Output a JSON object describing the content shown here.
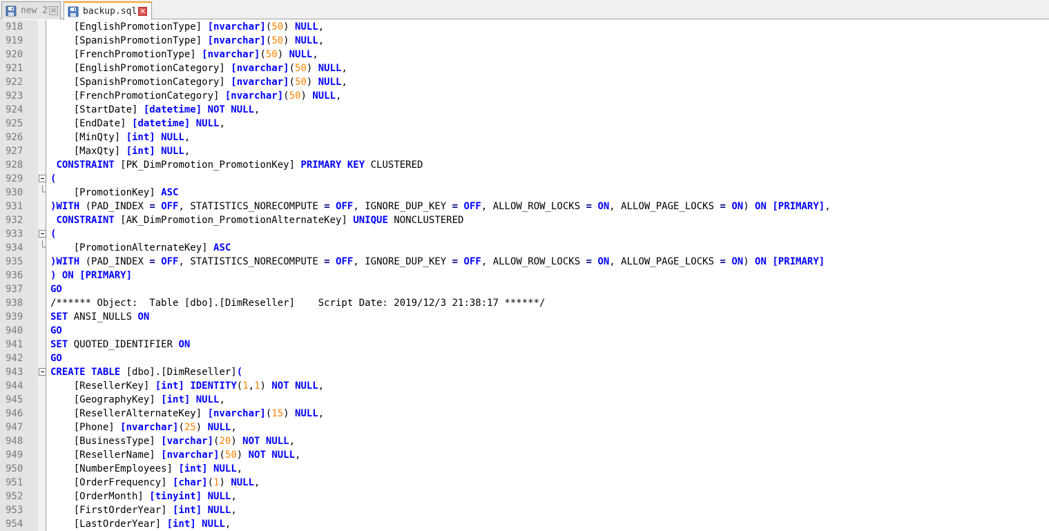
{
  "tabs": [
    {
      "label": "new 2",
      "active": false
    },
    {
      "label": "backup.sql",
      "active": true
    }
  ],
  "colors": {
    "keyword": "#0000ff",
    "number": "#ff8000",
    "operator": "#000080",
    "tab_accent": "#f6a623"
  },
  "icons": {
    "tab_icon": "save-disk-icon",
    "tab_close": "close-icon",
    "fold": "fold-minus-icon"
  },
  "editor": {
    "lines": [
      {
        "num": "918",
        "fold": "",
        "tokens": [
          [
            "t",
            "    [EnglishPromotionType] "
          ],
          [
            "k",
            "[nvarchar]"
          ],
          [
            "t",
            "("
          ],
          [
            "n",
            "50"
          ],
          [
            "t",
            ") "
          ],
          [
            "k",
            "NULL"
          ],
          [
            "t",
            ","
          ]
        ]
      },
      {
        "num": "919",
        "fold": "",
        "tokens": [
          [
            "t",
            "    [SpanishPromotionType] "
          ],
          [
            "k",
            "[nvarchar]"
          ],
          [
            "t",
            "("
          ],
          [
            "n",
            "50"
          ],
          [
            "t",
            ") "
          ],
          [
            "k",
            "NULL"
          ],
          [
            "t",
            ","
          ]
        ]
      },
      {
        "num": "920",
        "fold": "",
        "tokens": [
          [
            "t",
            "    [FrenchPromotionType] "
          ],
          [
            "k",
            "[nvarchar]"
          ],
          [
            "t",
            "("
          ],
          [
            "n",
            "50"
          ],
          [
            "t",
            ") "
          ],
          [
            "k",
            "NULL"
          ],
          [
            "t",
            ","
          ]
        ]
      },
      {
        "num": "921",
        "fold": "",
        "tokens": [
          [
            "t",
            "    [EnglishPromotionCategory] "
          ],
          [
            "k",
            "[nvarchar]"
          ],
          [
            "t",
            "("
          ],
          [
            "n",
            "50"
          ],
          [
            "t",
            ") "
          ],
          [
            "k",
            "NULL"
          ],
          [
            "t",
            ","
          ]
        ]
      },
      {
        "num": "922",
        "fold": "",
        "tokens": [
          [
            "t",
            "    [SpanishPromotionCategory] "
          ],
          [
            "k",
            "[nvarchar]"
          ],
          [
            "t",
            "("
          ],
          [
            "n",
            "50"
          ],
          [
            "t",
            ") "
          ],
          [
            "k",
            "NULL"
          ],
          [
            "t",
            ","
          ]
        ]
      },
      {
        "num": "923",
        "fold": "",
        "tokens": [
          [
            "t",
            "    [FrenchPromotionCategory] "
          ],
          [
            "k",
            "[nvarchar]"
          ],
          [
            "t",
            "("
          ],
          [
            "n",
            "50"
          ],
          [
            "t",
            ") "
          ],
          [
            "k",
            "NULL"
          ],
          [
            "t",
            ","
          ]
        ]
      },
      {
        "num": "924",
        "fold": "",
        "tokens": [
          [
            "t",
            "    [StartDate] "
          ],
          [
            "k",
            "[datetime]"
          ],
          [
            "t",
            " "
          ],
          [
            "k",
            "NOT NULL"
          ],
          [
            "t",
            ","
          ]
        ]
      },
      {
        "num": "925",
        "fold": "",
        "tokens": [
          [
            "t",
            "    [EndDate] "
          ],
          [
            "k",
            "[datetime]"
          ],
          [
            "t",
            " "
          ],
          [
            "k",
            "NULL"
          ],
          [
            "t",
            ","
          ]
        ]
      },
      {
        "num": "926",
        "fold": "",
        "tokens": [
          [
            "t",
            "    [MinQty] "
          ],
          [
            "k",
            "[int]"
          ],
          [
            "t",
            " "
          ],
          [
            "k",
            "NULL"
          ],
          [
            "t",
            ","
          ]
        ]
      },
      {
        "num": "927",
        "fold": "",
        "tokens": [
          [
            "t",
            "    [MaxQty] "
          ],
          [
            "k",
            "[int]"
          ],
          [
            "t",
            " "
          ],
          [
            "k",
            "NULL"
          ],
          [
            "t",
            ","
          ]
        ]
      },
      {
        "num": "928",
        "fold": "",
        "tokens": [
          [
            "t",
            " "
          ],
          [
            "k",
            "CONSTRAINT"
          ],
          [
            "t",
            " [PK_DimPromotion_PromotionKey] "
          ],
          [
            "k",
            "PRIMARY KEY"
          ],
          [
            "t",
            " CLUSTERED"
          ]
        ]
      },
      {
        "num": "929",
        "fold": "open",
        "tokens": [
          [
            "k",
            "("
          ]
        ]
      },
      {
        "num": "930",
        "fold": "end",
        "tokens": [
          [
            "t",
            "    [PromotionKey] "
          ],
          [
            "k",
            "ASC"
          ]
        ]
      },
      {
        "num": "931",
        "fold": "",
        "tokens": [
          [
            "k",
            ")WITH"
          ],
          [
            "t",
            " (PAD_INDEX "
          ],
          [
            "o",
            "="
          ],
          [
            "t",
            " "
          ],
          [
            "k",
            "OFF"
          ],
          [
            "t",
            ", STATISTICS_NORECOMPUTE "
          ],
          [
            "o",
            "="
          ],
          [
            "t",
            " "
          ],
          [
            "k",
            "OFF"
          ],
          [
            "t",
            ", IGNORE_DUP_KEY "
          ],
          [
            "o",
            "="
          ],
          [
            "t",
            " "
          ],
          [
            "k",
            "OFF"
          ],
          [
            "t",
            ", ALLOW_ROW_LOCKS "
          ],
          [
            "o",
            "="
          ],
          [
            "t",
            " "
          ],
          [
            "k",
            "ON"
          ],
          [
            "t",
            ", ALLOW_PAGE_LOCKS "
          ],
          [
            "o",
            "="
          ],
          [
            "t",
            " "
          ],
          [
            "k",
            "ON"
          ],
          [
            "t",
            ") "
          ],
          [
            "k",
            "ON"
          ],
          [
            "t",
            " "
          ],
          [
            "k",
            "[PRIMARY]"
          ],
          [
            "t",
            ","
          ]
        ]
      },
      {
        "num": "932",
        "fold": "",
        "tokens": [
          [
            "t",
            " "
          ],
          [
            "k",
            "CONSTRAINT"
          ],
          [
            "t",
            " [AK_DimPromotion_PromotionAlternateKey] "
          ],
          [
            "k",
            "UNIQUE"
          ],
          [
            "t",
            " NONCLUSTERED"
          ]
        ]
      },
      {
        "num": "933",
        "fold": "open",
        "tokens": [
          [
            "k",
            "("
          ]
        ]
      },
      {
        "num": "934",
        "fold": "end",
        "tokens": [
          [
            "t",
            "    [PromotionAlternateKey] "
          ],
          [
            "k",
            "ASC"
          ]
        ]
      },
      {
        "num": "935",
        "fold": "",
        "tokens": [
          [
            "k",
            ")WITH"
          ],
          [
            "t",
            " (PAD_INDEX "
          ],
          [
            "o",
            "="
          ],
          [
            "t",
            " "
          ],
          [
            "k",
            "OFF"
          ],
          [
            "t",
            ", STATISTICS_NORECOMPUTE "
          ],
          [
            "o",
            "="
          ],
          [
            "t",
            " "
          ],
          [
            "k",
            "OFF"
          ],
          [
            "t",
            ", IGNORE_DUP_KEY "
          ],
          [
            "o",
            "="
          ],
          [
            "t",
            " "
          ],
          [
            "k",
            "OFF"
          ],
          [
            "t",
            ", ALLOW_ROW_LOCKS "
          ],
          [
            "o",
            "="
          ],
          [
            "t",
            " "
          ],
          [
            "k",
            "ON"
          ],
          [
            "t",
            ", ALLOW_PAGE_LOCKS "
          ],
          [
            "o",
            "="
          ],
          [
            "t",
            " "
          ],
          [
            "k",
            "ON"
          ],
          [
            "t",
            ") "
          ],
          [
            "k",
            "ON"
          ],
          [
            "t",
            " "
          ],
          [
            "k",
            "[PRIMARY]"
          ]
        ]
      },
      {
        "num": "936",
        "fold": "",
        "tokens": [
          [
            "k",
            ")"
          ],
          [
            "t",
            " "
          ],
          [
            "k",
            "ON"
          ],
          [
            "t",
            " "
          ],
          [
            "k",
            "[PRIMARY]"
          ]
        ]
      },
      {
        "num": "937",
        "fold": "",
        "tokens": [
          [
            "k",
            "GO"
          ]
        ]
      },
      {
        "num": "938",
        "fold": "",
        "tokens": [
          [
            "c",
            "/****** Object:  Table [dbo].[DimReseller]    Script Date: 2019/12/3 21:38:17 ******/"
          ]
        ]
      },
      {
        "num": "939",
        "fold": "",
        "tokens": [
          [
            "k",
            "SET"
          ],
          [
            "t",
            " ANSI_NULLS "
          ],
          [
            "k",
            "ON"
          ]
        ]
      },
      {
        "num": "940",
        "fold": "",
        "tokens": [
          [
            "k",
            "GO"
          ]
        ]
      },
      {
        "num": "941",
        "fold": "",
        "tokens": [
          [
            "k",
            "SET"
          ],
          [
            "t",
            " QUOTED_IDENTIFIER "
          ],
          [
            "k",
            "ON"
          ]
        ]
      },
      {
        "num": "942",
        "fold": "",
        "tokens": [
          [
            "k",
            "GO"
          ]
        ]
      },
      {
        "num": "943",
        "fold": "open",
        "tokens": [
          [
            "k",
            "CREATE TABLE"
          ],
          [
            "t",
            " [dbo].[DimReseller]"
          ],
          [
            "k",
            "("
          ]
        ]
      },
      {
        "num": "944",
        "fold": "",
        "tokens": [
          [
            "t",
            "    [ResellerKey] "
          ],
          [
            "k",
            "[int]"
          ],
          [
            "t",
            " "
          ],
          [
            "k",
            "IDENTITY"
          ],
          [
            "t",
            "("
          ],
          [
            "n",
            "1"
          ],
          [
            "t",
            ","
          ],
          [
            "n",
            "1"
          ],
          [
            "t",
            ") "
          ],
          [
            "k",
            "NOT NULL"
          ],
          [
            "t",
            ","
          ]
        ]
      },
      {
        "num": "945",
        "fold": "",
        "tokens": [
          [
            "t",
            "    [GeographyKey] "
          ],
          [
            "k",
            "[int]"
          ],
          [
            "t",
            " "
          ],
          [
            "k",
            "NULL"
          ],
          [
            "t",
            ","
          ]
        ]
      },
      {
        "num": "946",
        "fold": "",
        "tokens": [
          [
            "t",
            "    [ResellerAlternateKey] "
          ],
          [
            "k",
            "[nvarchar]"
          ],
          [
            "t",
            "("
          ],
          [
            "n",
            "15"
          ],
          [
            "t",
            ") "
          ],
          [
            "k",
            "NULL"
          ],
          [
            "t",
            ","
          ]
        ]
      },
      {
        "num": "947",
        "fold": "",
        "tokens": [
          [
            "t",
            "    [Phone] "
          ],
          [
            "k",
            "[nvarchar]"
          ],
          [
            "t",
            "("
          ],
          [
            "n",
            "25"
          ],
          [
            "t",
            ") "
          ],
          [
            "k",
            "NULL"
          ],
          [
            "t",
            ","
          ]
        ]
      },
      {
        "num": "948",
        "fold": "",
        "tokens": [
          [
            "t",
            "    [BusinessType] "
          ],
          [
            "k",
            "[varchar]"
          ],
          [
            "t",
            "("
          ],
          [
            "n",
            "20"
          ],
          [
            "t",
            ") "
          ],
          [
            "k",
            "NOT NULL"
          ],
          [
            "t",
            ","
          ]
        ]
      },
      {
        "num": "949",
        "fold": "",
        "tokens": [
          [
            "t",
            "    [ResellerName] "
          ],
          [
            "k",
            "[nvarchar]"
          ],
          [
            "t",
            "("
          ],
          [
            "n",
            "50"
          ],
          [
            "t",
            ") "
          ],
          [
            "k",
            "NOT NULL"
          ],
          [
            "t",
            ","
          ]
        ]
      },
      {
        "num": "950",
        "fold": "",
        "tokens": [
          [
            "t",
            "    [NumberEmployees] "
          ],
          [
            "k",
            "[int]"
          ],
          [
            "t",
            " "
          ],
          [
            "k",
            "NULL"
          ],
          [
            "t",
            ","
          ]
        ]
      },
      {
        "num": "951",
        "fold": "",
        "tokens": [
          [
            "t",
            "    [OrderFrequency] "
          ],
          [
            "k",
            "[char]"
          ],
          [
            "t",
            "("
          ],
          [
            "n",
            "1"
          ],
          [
            "t",
            ") "
          ],
          [
            "k",
            "NULL"
          ],
          [
            "t",
            ","
          ]
        ]
      },
      {
        "num": "952",
        "fold": "",
        "tokens": [
          [
            "t",
            "    [OrderMonth] "
          ],
          [
            "k",
            "[tinyint]"
          ],
          [
            "t",
            " "
          ],
          [
            "k",
            "NULL"
          ],
          [
            "t",
            ","
          ]
        ]
      },
      {
        "num": "953",
        "fold": "",
        "tokens": [
          [
            "t",
            "    [FirstOrderYear] "
          ],
          [
            "k",
            "[int]"
          ],
          [
            "t",
            " "
          ],
          [
            "k",
            "NULL"
          ],
          [
            "t",
            ","
          ]
        ]
      },
      {
        "num": "954",
        "fold": "",
        "tokens": [
          [
            "t",
            "    [LastOrderYear] "
          ],
          [
            "k",
            "[int]"
          ],
          [
            "t",
            " "
          ],
          [
            "k",
            "NULL"
          ],
          [
            "t",
            ","
          ]
        ]
      }
    ]
  }
}
